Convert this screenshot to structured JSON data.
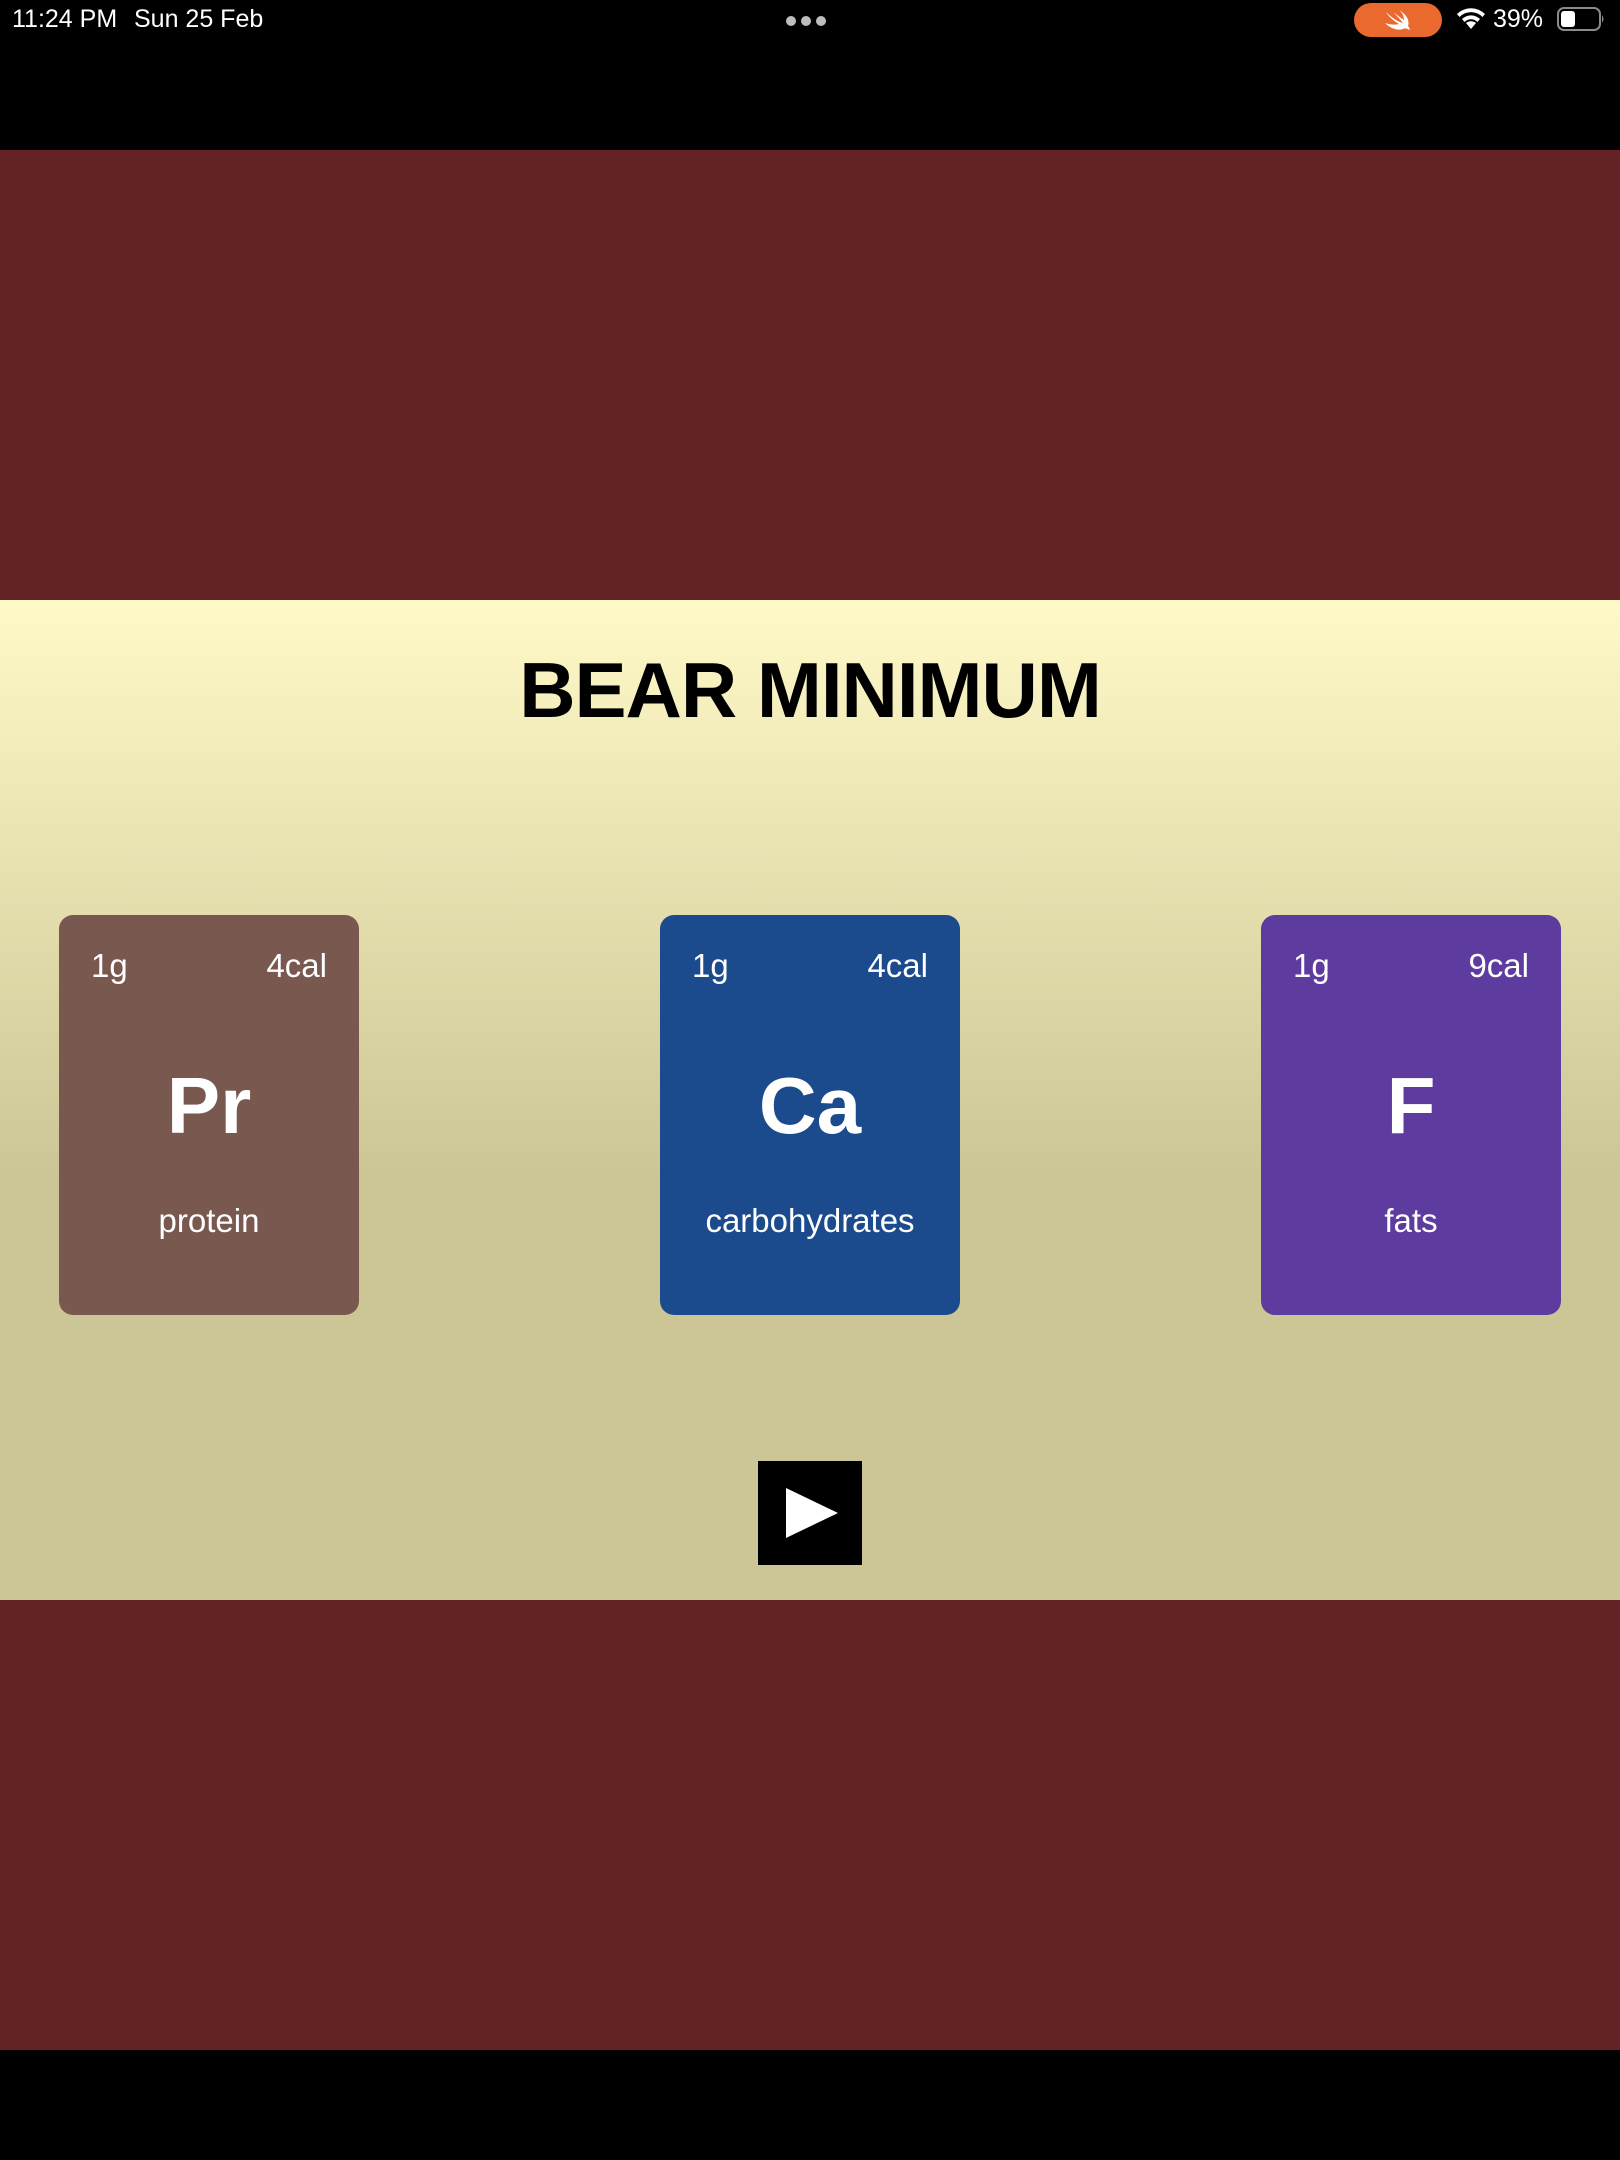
{
  "status_bar": {
    "time": "11:24 PM",
    "date": "Sun 25 Feb",
    "battery_percent": "39%",
    "battery_level": 0.39,
    "icons": [
      "multitask-dots-icon",
      "swift-icon",
      "wifi-icon",
      "battery-icon"
    ],
    "swift_color": "#E9692E"
  },
  "app": {
    "title": "BEAR MINIMUM",
    "banner_color": "#632225",
    "background_gradient": [
      "#FFF9C8",
      "#CCC696"
    ],
    "play_icon": "play-icon"
  },
  "cards": [
    {
      "grams": "1g",
      "calories": "4cal",
      "symbol": "Pr",
      "name": "protein",
      "color": "#795850"
    },
    {
      "grams": "1g",
      "calories": "4cal",
      "symbol": "Ca",
      "name": "carbohydrates",
      "color": "#1B4A8D"
    },
    {
      "grams": "1g",
      "calories": "9cal",
      "symbol": "F",
      "name": "fats",
      "color": "#5E3B9E"
    }
  ]
}
